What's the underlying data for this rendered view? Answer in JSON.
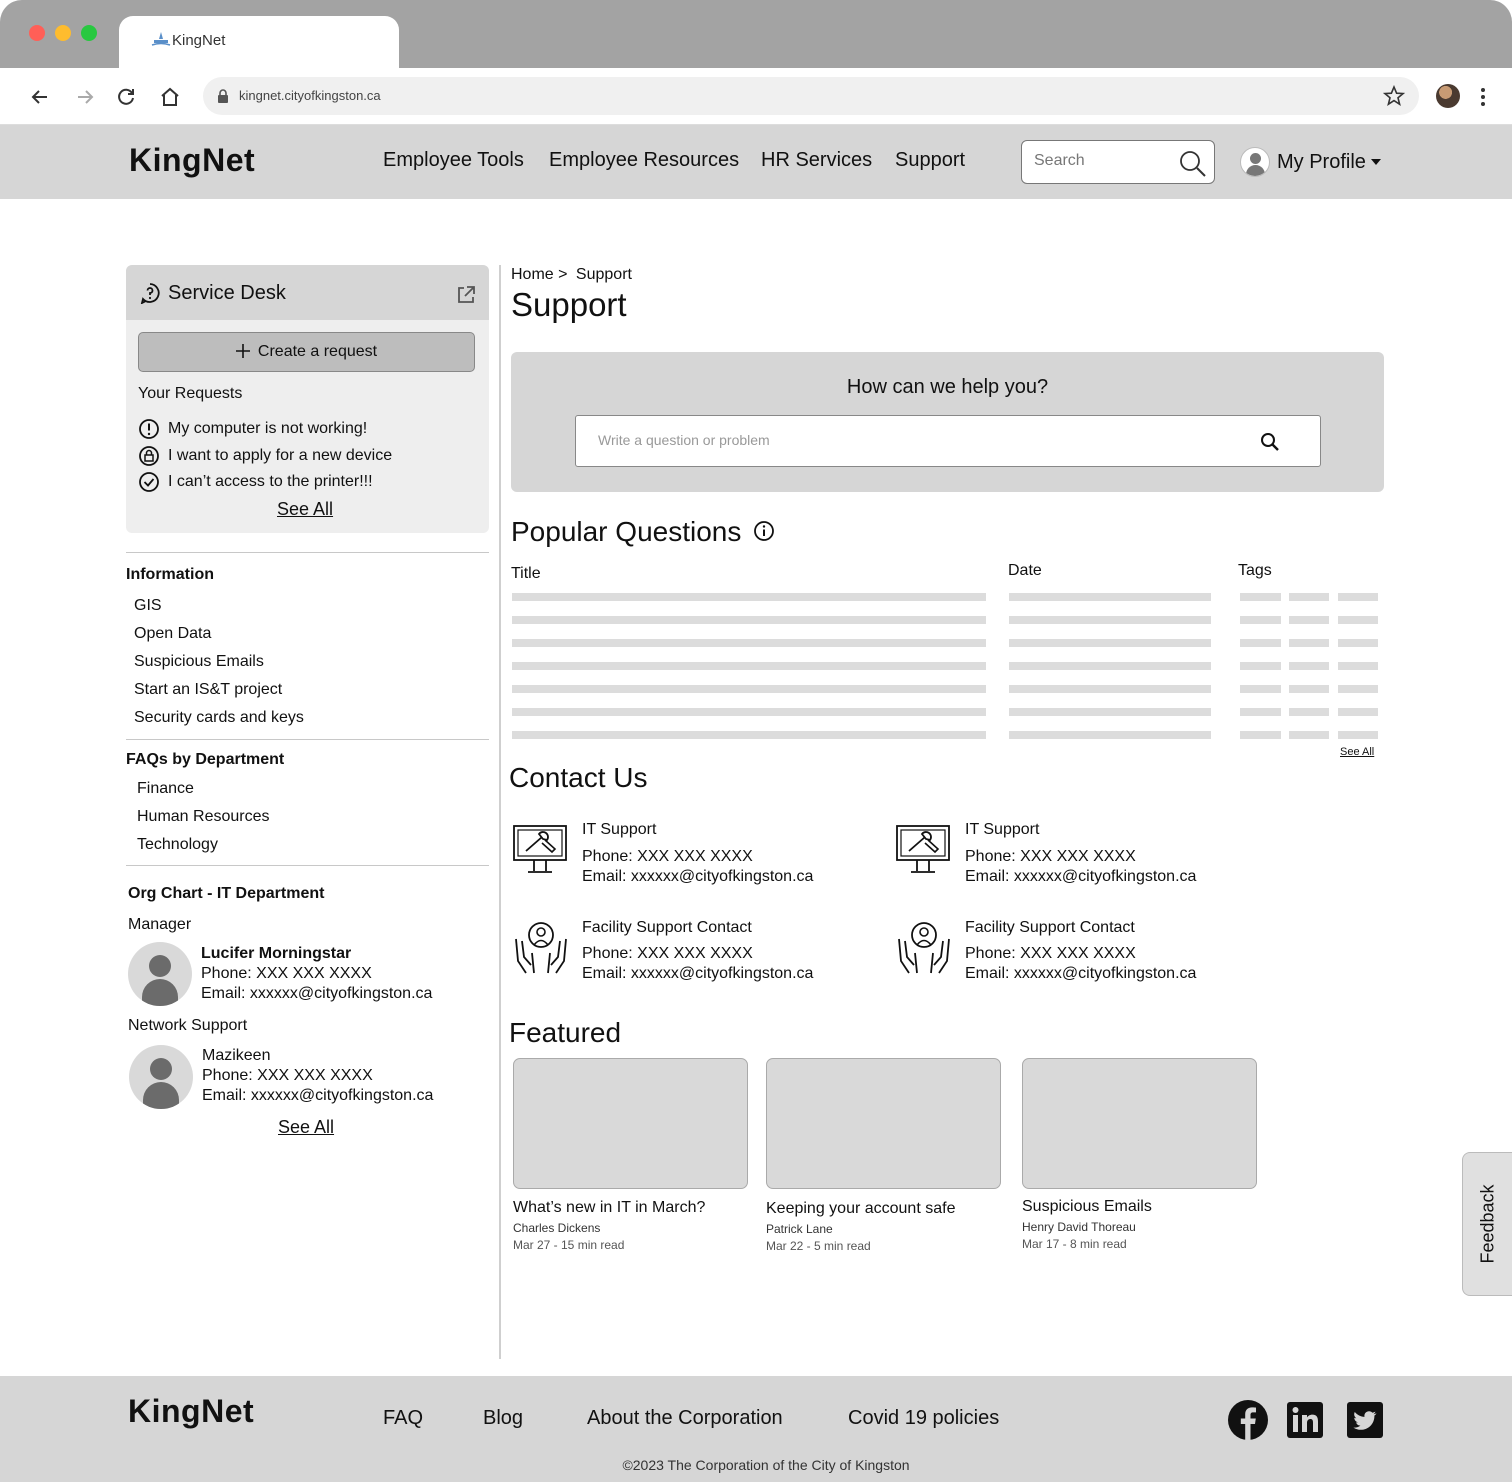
{
  "browser": {
    "tab_title": "KingNet",
    "url": "kingnet.cityofkingston.ca"
  },
  "header": {
    "logo": "KingNet",
    "nav": [
      "Employee Tools",
      "Employee Resources",
      "HR Services",
      "Support"
    ],
    "search_placeholder": "Search",
    "profile_label": "My Profile"
  },
  "service_desk": {
    "title": "Service Desk",
    "create_label": "Create a request",
    "requests_heading": "Your Requests",
    "requests": [
      {
        "text": "My computer is not working!",
        "status_icon": "alert-circle-icon"
      },
      {
        "text": "I want to apply for a new device",
        "status_icon": "pending-lock-icon"
      },
      {
        "text": "I can’t access to the printer!!!",
        "status_icon": "check-circle-icon"
      }
    ],
    "see_all": "See All"
  },
  "information": {
    "heading": "Information",
    "links": [
      "GIS",
      "Open Data",
      "Suspicious Emails",
      "Start an IS&T project",
      "Security cards and keys"
    ]
  },
  "faqs": {
    "heading": "FAQs by Department",
    "links": [
      "Finance",
      "Human Resources",
      "Technology"
    ]
  },
  "org_chart": {
    "heading": "Org Chart - IT Department",
    "groups": [
      {
        "role": "Manager",
        "name": "Lucifer Morningstar",
        "phone": "Phone: XXX XXX XXXX",
        "email": "Email:  xxxxxx@cityofkingston.ca"
      },
      {
        "role": "Network Support",
        "name": "Mazikeen",
        "phone": "Phone: XXX XXX XXXX",
        "email": "Email:  xxxxxx@cityofkingston.ca"
      }
    ],
    "see_all": "See All"
  },
  "main": {
    "breadcrumb": {
      "home": "Home >",
      "current": "Support"
    },
    "title": "Support",
    "help": {
      "title": "How can we help you?",
      "placeholder": "Write a question or problem"
    },
    "popular": {
      "title": "Popular Questions",
      "columns": [
        "Title",
        "Date",
        "Tags"
      ],
      "see_all": "See All"
    },
    "contact": {
      "title": "Contact Us",
      "items": [
        {
          "name": "IT Support",
          "phone": "Phone: XXX XXX XXXX",
          "email": "Email:  xxxxxx@cityofkingston.ca",
          "icon": "computer-repair-icon"
        },
        {
          "name": "IT Support",
          "phone": "Phone: XXX XXX XXXX",
          "email": "Email:  xxxxxx@cityofkingston.ca",
          "icon": "computer-repair-icon"
        },
        {
          "name": "Facility Support Contact",
          "phone": "Phone: XXX XXX XXXX",
          "email": "Email:  xxxxxx@cityofkingston.ca",
          "icon": "helping-hands-icon"
        },
        {
          "name": "Facility Support Contact",
          "phone": "Phone: XXX XXX XXXX",
          "email": "Email:  xxxxxx@cityofkingston.ca",
          "icon": "helping-hands-icon"
        }
      ]
    },
    "featured": {
      "title": "Featured",
      "cards": [
        {
          "title": "What’s new in IT in March?",
          "author": "Charles Dickens",
          "meta": "Mar 27 - 15 min read"
        },
        {
          "title": "Keeping your account safe",
          "author": "Patrick Lane",
          "meta": "Mar 22 - 5 min read"
        },
        {
          "title": "Suspicious Emails",
          "author": "Henry David Thoreau",
          "meta": "Mar 17 - 8 min read"
        }
      ]
    }
  },
  "feedback_label": "Feedback",
  "footer": {
    "logo": "KingNet",
    "links": [
      "FAQ",
      "Blog",
      "About the Corporation",
      "Covid 19 policies"
    ],
    "copyright": "©2023 The Corporation of the City of Kingston",
    "social": [
      "facebook-icon",
      "linkedin-icon",
      "twitter-icon"
    ]
  }
}
